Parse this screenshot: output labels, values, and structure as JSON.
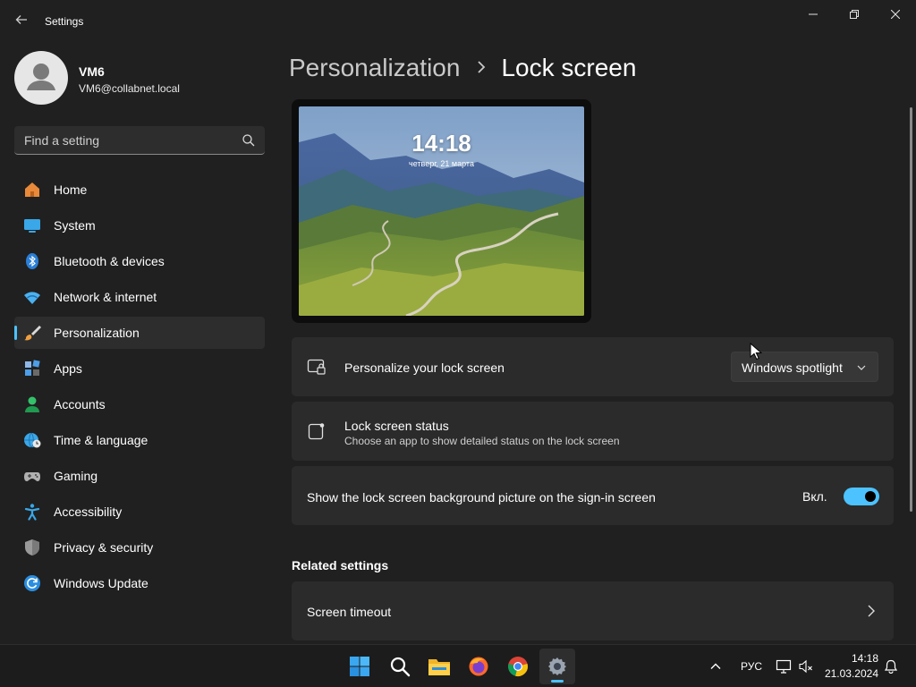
{
  "window": {
    "title": "Settings"
  },
  "profile": {
    "name": "VM6",
    "email": "VM6@collabnet.local"
  },
  "search": {
    "placeholder": "Find a setting"
  },
  "sidebar": {
    "items": [
      {
        "label": "Home",
        "icon": "home-icon"
      },
      {
        "label": "System",
        "icon": "system-icon"
      },
      {
        "label": "Bluetooth & devices",
        "icon": "bluetooth-icon"
      },
      {
        "label": "Network & internet",
        "icon": "wifi-icon"
      },
      {
        "label": "Personalization",
        "icon": "brush-icon",
        "active": true
      },
      {
        "label": "Apps",
        "icon": "apps-icon"
      },
      {
        "label": "Accounts",
        "icon": "person-icon"
      },
      {
        "label": "Time & language",
        "icon": "clock-globe-icon"
      },
      {
        "label": "Gaming",
        "icon": "gamepad-icon"
      },
      {
        "label": "Accessibility",
        "icon": "accessibility-icon"
      },
      {
        "label": "Privacy & security",
        "icon": "shield-icon"
      },
      {
        "label": "Windows Update",
        "icon": "refresh-icon"
      }
    ]
  },
  "breadcrumb": {
    "parent": "Personalization",
    "current": "Lock screen"
  },
  "preview": {
    "time": "14:18",
    "date": "четверг, 21 марта"
  },
  "cards": {
    "personalize": {
      "title": "Personalize your lock screen",
      "dropdown_value": "Windows spotlight"
    },
    "status": {
      "title": "Lock screen status",
      "subtitle": "Choose an app to show detailed status on the lock screen"
    },
    "signin_bg": {
      "title": "Show the lock screen background picture on the sign-in screen",
      "toggle_label": "Вкл.",
      "toggle_on": true
    }
  },
  "related": {
    "heading": "Related settings",
    "items": [
      {
        "label": "Screen timeout"
      }
    ]
  },
  "taskbar": {
    "apps": [
      "start-icon",
      "search-icon",
      "file-explorer-icon",
      "firefox-icon",
      "chrome-icon",
      "settings-icon"
    ],
    "language": "РУС",
    "time": "14:18",
    "date": "21.03.2024"
  },
  "colors": {
    "accent": "#4cc2ff",
    "background": "#202020",
    "card": "#2b2b2b"
  }
}
